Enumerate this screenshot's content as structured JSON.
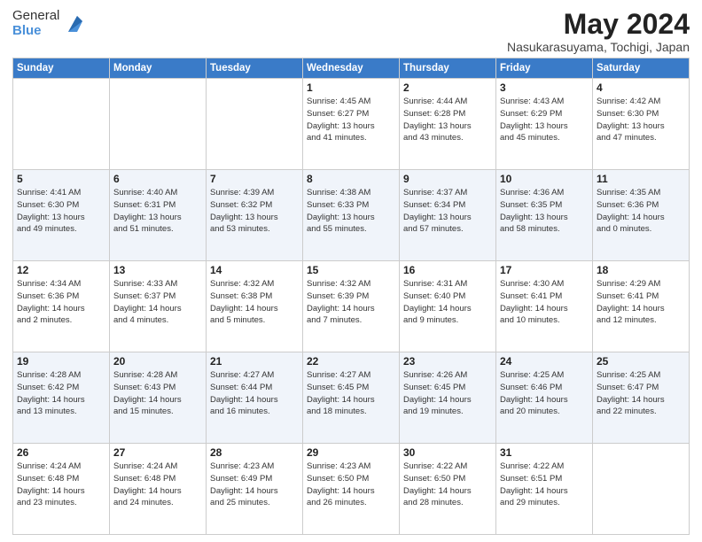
{
  "header": {
    "logo_general": "General",
    "logo_blue": "Blue",
    "month_year": "May 2024",
    "location": "Nasukarasuyama, Tochigi, Japan"
  },
  "days_of_week": [
    "Sunday",
    "Monday",
    "Tuesday",
    "Wednesday",
    "Thursday",
    "Friday",
    "Saturday"
  ],
  "weeks": [
    [
      {
        "day": "",
        "info": ""
      },
      {
        "day": "",
        "info": ""
      },
      {
        "day": "",
        "info": ""
      },
      {
        "day": "1",
        "info": "Sunrise: 4:45 AM\nSunset: 6:27 PM\nDaylight: 13 hours\nand 41 minutes."
      },
      {
        "day": "2",
        "info": "Sunrise: 4:44 AM\nSunset: 6:28 PM\nDaylight: 13 hours\nand 43 minutes."
      },
      {
        "day": "3",
        "info": "Sunrise: 4:43 AM\nSunset: 6:29 PM\nDaylight: 13 hours\nand 45 minutes."
      },
      {
        "day": "4",
        "info": "Sunrise: 4:42 AM\nSunset: 6:30 PM\nDaylight: 13 hours\nand 47 minutes."
      }
    ],
    [
      {
        "day": "5",
        "info": "Sunrise: 4:41 AM\nSunset: 6:30 PM\nDaylight: 13 hours\nand 49 minutes."
      },
      {
        "day": "6",
        "info": "Sunrise: 4:40 AM\nSunset: 6:31 PM\nDaylight: 13 hours\nand 51 minutes."
      },
      {
        "day": "7",
        "info": "Sunrise: 4:39 AM\nSunset: 6:32 PM\nDaylight: 13 hours\nand 53 minutes."
      },
      {
        "day": "8",
        "info": "Sunrise: 4:38 AM\nSunset: 6:33 PM\nDaylight: 13 hours\nand 55 minutes."
      },
      {
        "day": "9",
        "info": "Sunrise: 4:37 AM\nSunset: 6:34 PM\nDaylight: 13 hours\nand 57 minutes."
      },
      {
        "day": "10",
        "info": "Sunrise: 4:36 AM\nSunset: 6:35 PM\nDaylight: 13 hours\nand 58 minutes."
      },
      {
        "day": "11",
        "info": "Sunrise: 4:35 AM\nSunset: 6:36 PM\nDaylight: 14 hours\nand 0 minutes."
      }
    ],
    [
      {
        "day": "12",
        "info": "Sunrise: 4:34 AM\nSunset: 6:36 PM\nDaylight: 14 hours\nand 2 minutes."
      },
      {
        "day": "13",
        "info": "Sunrise: 4:33 AM\nSunset: 6:37 PM\nDaylight: 14 hours\nand 4 minutes."
      },
      {
        "day": "14",
        "info": "Sunrise: 4:32 AM\nSunset: 6:38 PM\nDaylight: 14 hours\nand 5 minutes."
      },
      {
        "day": "15",
        "info": "Sunrise: 4:32 AM\nSunset: 6:39 PM\nDaylight: 14 hours\nand 7 minutes."
      },
      {
        "day": "16",
        "info": "Sunrise: 4:31 AM\nSunset: 6:40 PM\nDaylight: 14 hours\nand 9 minutes."
      },
      {
        "day": "17",
        "info": "Sunrise: 4:30 AM\nSunset: 6:41 PM\nDaylight: 14 hours\nand 10 minutes."
      },
      {
        "day": "18",
        "info": "Sunrise: 4:29 AM\nSunset: 6:41 PM\nDaylight: 14 hours\nand 12 minutes."
      }
    ],
    [
      {
        "day": "19",
        "info": "Sunrise: 4:28 AM\nSunset: 6:42 PM\nDaylight: 14 hours\nand 13 minutes."
      },
      {
        "day": "20",
        "info": "Sunrise: 4:28 AM\nSunset: 6:43 PM\nDaylight: 14 hours\nand 15 minutes."
      },
      {
        "day": "21",
        "info": "Sunrise: 4:27 AM\nSunset: 6:44 PM\nDaylight: 14 hours\nand 16 minutes."
      },
      {
        "day": "22",
        "info": "Sunrise: 4:27 AM\nSunset: 6:45 PM\nDaylight: 14 hours\nand 18 minutes."
      },
      {
        "day": "23",
        "info": "Sunrise: 4:26 AM\nSunset: 6:45 PM\nDaylight: 14 hours\nand 19 minutes."
      },
      {
        "day": "24",
        "info": "Sunrise: 4:25 AM\nSunset: 6:46 PM\nDaylight: 14 hours\nand 20 minutes."
      },
      {
        "day": "25",
        "info": "Sunrise: 4:25 AM\nSunset: 6:47 PM\nDaylight: 14 hours\nand 22 minutes."
      }
    ],
    [
      {
        "day": "26",
        "info": "Sunrise: 4:24 AM\nSunset: 6:48 PM\nDaylight: 14 hours\nand 23 minutes."
      },
      {
        "day": "27",
        "info": "Sunrise: 4:24 AM\nSunset: 6:48 PM\nDaylight: 14 hours\nand 24 minutes."
      },
      {
        "day": "28",
        "info": "Sunrise: 4:23 AM\nSunset: 6:49 PM\nDaylight: 14 hours\nand 25 minutes."
      },
      {
        "day": "29",
        "info": "Sunrise: 4:23 AM\nSunset: 6:50 PM\nDaylight: 14 hours\nand 26 minutes."
      },
      {
        "day": "30",
        "info": "Sunrise: 4:22 AM\nSunset: 6:50 PM\nDaylight: 14 hours\nand 28 minutes."
      },
      {
        "day": "31",
        "info": "Sunrise: 4:22 AM\nSunset: 6:51 PM\nDaylight: 14 hours\nand 29 minutes."
      },
      {
        "day": "",
        "info": ""
      }
    ]
  ]
}
